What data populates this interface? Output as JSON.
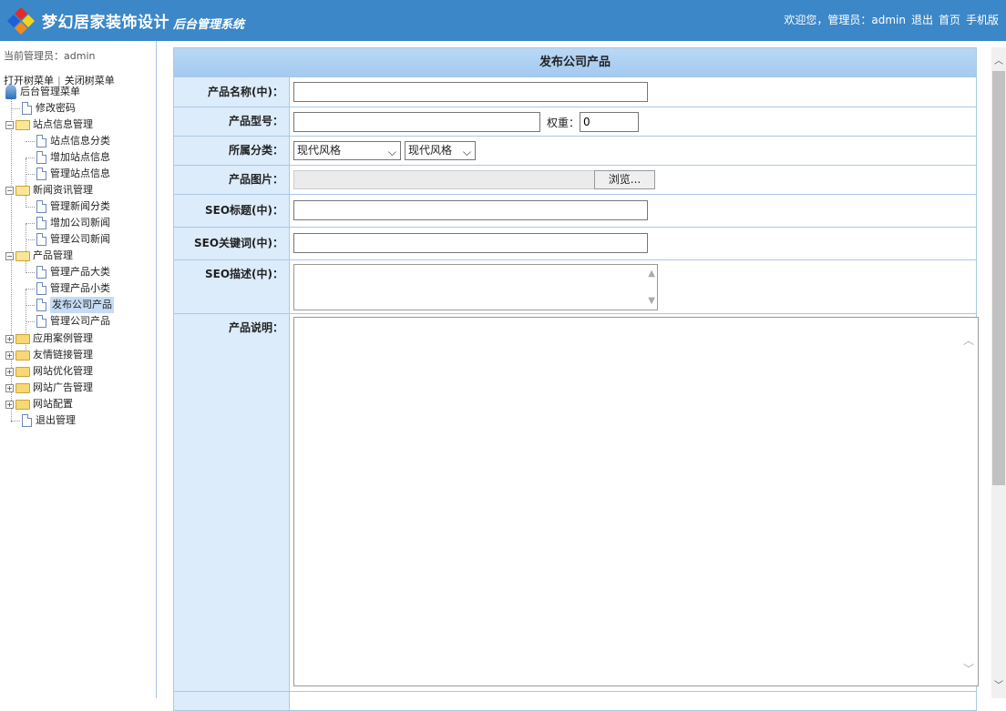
{
  "header": {
    "title": "梦幻居家装饰设计",
    "subtitle": "后台管理系统",
    "welcome": "欢迎您，管理员：admin",
    "links": [
      "退出",
      "首页",
      "手机版"
    ]
  },
  "sidebar": {
    "current_admin": "当前管理员：admin",
    "open_tree": "打开树菜单",
    "separator": "|",
    "close_tree": "关闭树菜单",
    "root": "后台管理菜单",
    "items": [
      {
        "label": "修改密码"
      },
      {
        "label": "站点信息管理"
      },
      {
        "label": "站点信息分类"
      },
      {
        "label": "增加站点信息"
      },
      {
        "label": "管理站点信息"
      },
      {
        "label": "新闻资讯管理"
      },
      {
        "label": "管理新闻分类"
      },
      {
        "label": "增加公司新闻"
      },
      {
        "label": "管理公司新闻"
      },
      {
        "label": "产品管理"
      },
      {
        "label": "管理产品大类"
      },
      {
        "label": "管理产品小类"
      },
      {
        "label": "发布公司产品"
      },
      {
        "label": "管理公司产品"
      },
      {
        "label": "应用案例管理"
      },
      {
        "label": "友情链接管理"
      },
      {
        "label": "网站优化管理"
      },
      {
        "label": "网站广告管理"
      },
      {
        "label": "网站配置"
      },
      {
        "label": "退出管理"
      }
    ]
  },
  "form": {
    "title": "发布公司产品",
    "product_name_label": "产品名称(中)：",
    "product_name_value": "",
    "model_label": "产品型号：",
    "model_value": "",
    "weight_label": "权重：",
    "weight_value": "0",
    "category_label": "所属分类：",
    "category_main": "现代风格",
    "category_sub": "现代风格",
    "image_label": "产品图片：",
    "browse_label": "浏览...",
    "seo_title_label": "SEO标题(中)：",
    "seo_keywords_label": "SEO关键词(中)：",
    "seo_desc_label": "SEO描述(中)：",
    "description_label": "产品说明："
  }
}
